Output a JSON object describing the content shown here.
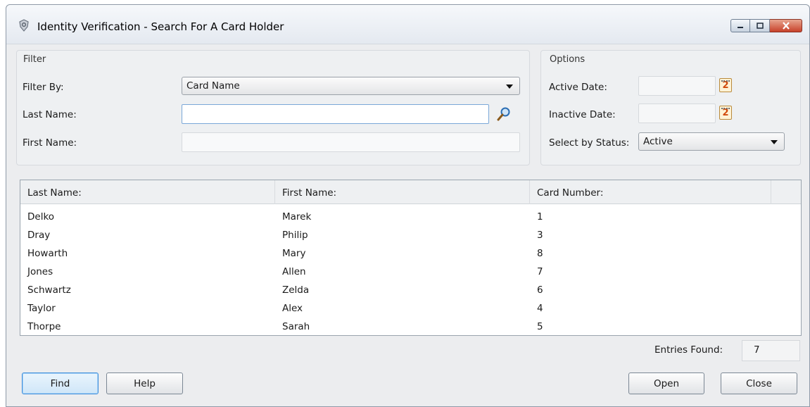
{
  "window": {
    "title": "Identity Verification - Search For A Card Holder"
  },
  "filter": {
    "group_label": "Filter",
    "filter_by_label": "Filter By:",
    "filter_by_value": "Card Name",
    "last_name_label": "Last Name:",
    "last_name_value": "",
    "first_name_label": "First Name:",
    "first_name_value": ""
  },
  "options": {
    "group_label": "Options",
    "active_date_label": "Active Date:",
    "active_date_value": "",
    "inactive_date_label": "Inactive Date:",
    "inactive_date_value": "",
    "calendar_glyph": "2",
    "status_label": "Select by Status:",
    "status_value": "Active"
  },
  "results": {
    "columns": [
      "Last Name:",
      "First Name:",
      "Card Number:"
    ],
    "rows": [
      [
        "Delko",
        "Marek",
        "1"
      ],
      [
        "Dray",
        "Philip",
        "3"
      ],
      [
        "Howarth",
        "Mary",
        "8"
      ],
      [
        "Jones",
        "Allen",
        "7"
      ],
      [
        "Schwartz",
        "Zelda",
        "6"
      ],
      [
        "Taylor",
        "Alex",
        "4"
      ],
      [
        "Thorpe",
        "Sarah",
        "5"
      ]
    ]
  },
  "footer": {
    "entries_label": "Entries Found:",
    "entries_value": "7",
    "find_label": "Find",
    "help_label": "Help",
    "open_label": "Open",
    "close_label": "Close"
  },
  "icons": {
    "app": "shield-icon",
    "search": "magnifier-icon",
    "calendar": "calendar-icon"
  },
  "colors": {
    "accent": "#3f8fdc",
    "close_button": "#c7412a"
  }
}
